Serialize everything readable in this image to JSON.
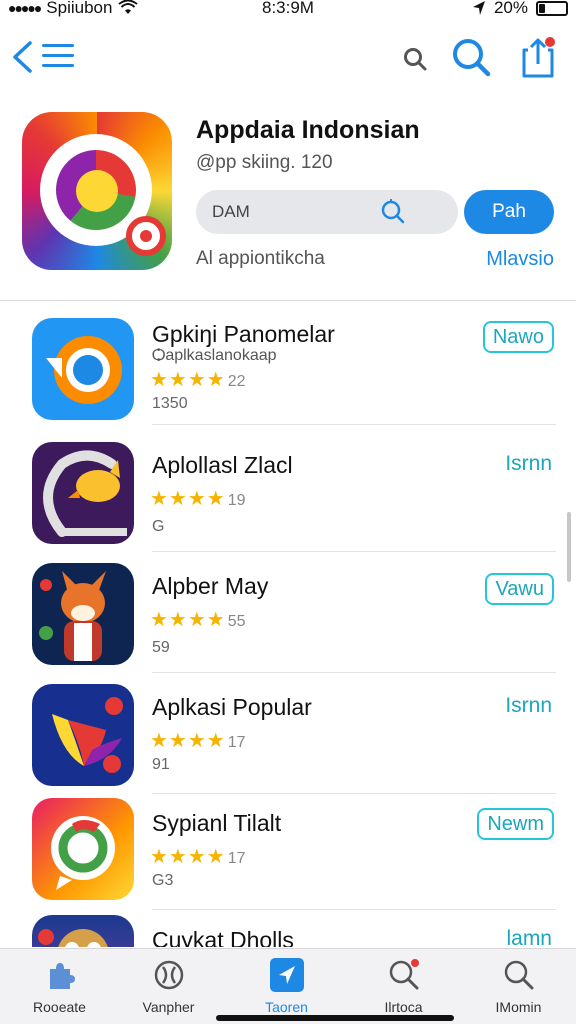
{
  "status_bar": {
    "carrier": "Spiiubon",
    "time": "8:3:9M",
    "battery": "20%"
  },
  "toolbar": {
    "back": "back-icon",
    "menu": "menu-icon",
    "search": "search-icon",
    "share": "share-icon"
  },
  "hero": {
    "title": "Appdaia Indonsian",
    "subtitle": "@pp skiing. 120",
    "field_value": "DAM",
    "get_button": "Pah",
    "caption": "Al appiontikcha",
    "link": "Mlavsio"
  },
  "apps": [
    {
      "name": "Gpkiŋi Panomelar",
      "developer": "Ѻaplkaslanokaap",
      "stars": "★★★★",
      "rating": "22",
      "meta": "1350",
      "action": "Nawo",
      "action_style": "pill",
      "icon": "chrome-style-icon"
    },
    {
      "name": "Aplollasl Zlacl",
      "developer": "",
      "stars": "★★★★",
      "rating": "19",
      "meta": "G",
      "action": "Isrnn",
      "action_style": "link",
      "icon": "cat-arc-icon"
    },
    {
      "name": "Alpber May",
      "developer": "",
      "stars": "★★★★",
      "rating": "55",
      "meta": "59",
      "action": "Vawu",
      "action_style": "pill",
      "icon": "fox-character-icon"
    },
    {
      "name": "Aplkasi Popular",
      "developer": "",
      "stars": "★★★★",
      "rating": "17",
      "meta": "91",
      "action": "Isrnn",
      "action_style": "link",
      "icon": "bird-flame-icon"
    },
    {
      "name": "Sypianl Tilalt",
      "developer": "",
      "stars": "★★★★",
      "rating": "17",
      "meta": "G3",
      "action": "Newm",
      "action_style": "pill",
      "icon": "chat-ring-icon"
    },
    {
      "name": "Cuykat Dholls",
      "developer": "",
      "stars": "",
      "rating": "",
      "meta": "",
      "action": "lamn",
      "action_style": "link",
      "icon": "character-icon"
    }
  ],
  "tabs": [
    {
      "label": "Rooeate",
      "icon": "puzzle-icon",
      "active": false
    },
    {
      "label": "Vanpher",
      "icon": "gamepad-icon",
      "active": false
    },
    {
      "label": "Taoren",
      "icon": "navigate-icon",
      "active": true
    },
    {
      "label": "Ilrtoca",
      "icon": "search-icon",
      "active": false
    },
    {
      "label": "IMomin",
      "icon": "search-icon",
      "active": false
    }
  ]
}
